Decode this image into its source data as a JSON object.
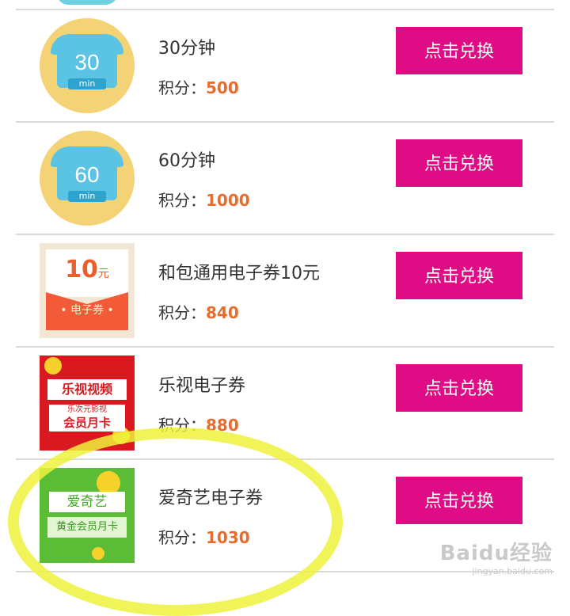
{
  "items": [
    {
      "name": "30分钟",
      "points_label": "积分：",
      "points": "500",
      "button": "点击兑换",
      "thumb_number": "30",
      "thumb_unit": "min"
    },
    {
      "name": "60分钟",
      "points_label": "积分：",
      "points": "1000",
      "button": "点击兑换",
      "thumb_number": "60",
      "thumb_unit": "min"
    },
    {
      "name": "和包通用电子券10元",
      "points_label": "积分：",
      "points": "840",
      "button": "点击兑换",
      "thumb_amount": "10",
      "thumb_currency": "元",
      "thumb_label": "• 电子券 •"
    },
    {
      "name": "乐视电子券",
      "points_label": "积分：",
      "points": "880",
      "button": "点击兑换",
      "thumb_logo": "乐视视频",
      "thumb_sub": "乐次元影视",
      "thumb_card": "会员月卡"
    },
    {
      "name": "爱奇艺电子券",
      "points_label": "积分：",
      "points": "1030",
      "button": "点击兑换",
      "thumb_logo": "爱奇艺",
      "thumb_card": "黄金会员月卡"
    }
  ],
  "watermark": {
    "main": "Baidu经验",
    "sub": "jingyan.baidu.com"
  },
  "colors": {
    "button": "#e00c85",
    "points": "#ea6c2c",
    "highlight": "#eef23c"
  }
}
